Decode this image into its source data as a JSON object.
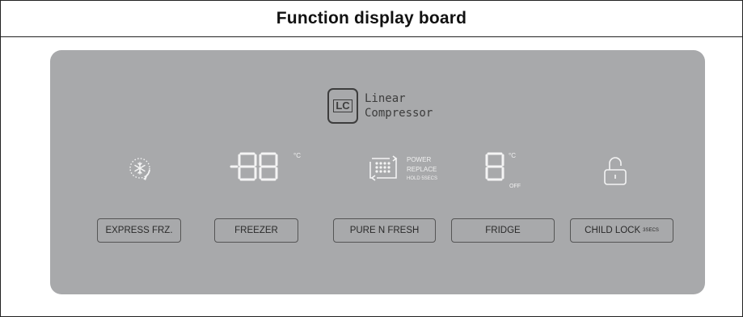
{
  "title": "Function display board",
  "logo": {
    "line1": "Linear",
    "line2": "Compressor"
  },
  "freezer_display": {
    "digits": "88",
    "unit": "°C"
  },
  "filter_indicator": {
    "line1": "POWER",
    "line2": "REPLACE",
    "line3": "HOLD 5SECS"
  },
  "fridge_display": {
    "digit": "8",
    "unit": "°C",
    "off_label": "OFF"
  },
  "buttons": {
    "express_frz": "EXPRESS FRZ.",
    "freezer": "FREEZER",
    "pure_n_fresh": "PURE N FRESH",
    "fridge": "FRIDGE",
    "child_lock": "CHILD LOCK",
    "child_lock_sub": "3SECS"
  },
  "colors": {
    "panel": "#a8a9ab",
    "segments": "#f4f4f4",
    "outline": "#555555"
  },
  "icons": [
    "snowflake-icon",
    "filter-icon",
    "lock-icon"
  ]
}
